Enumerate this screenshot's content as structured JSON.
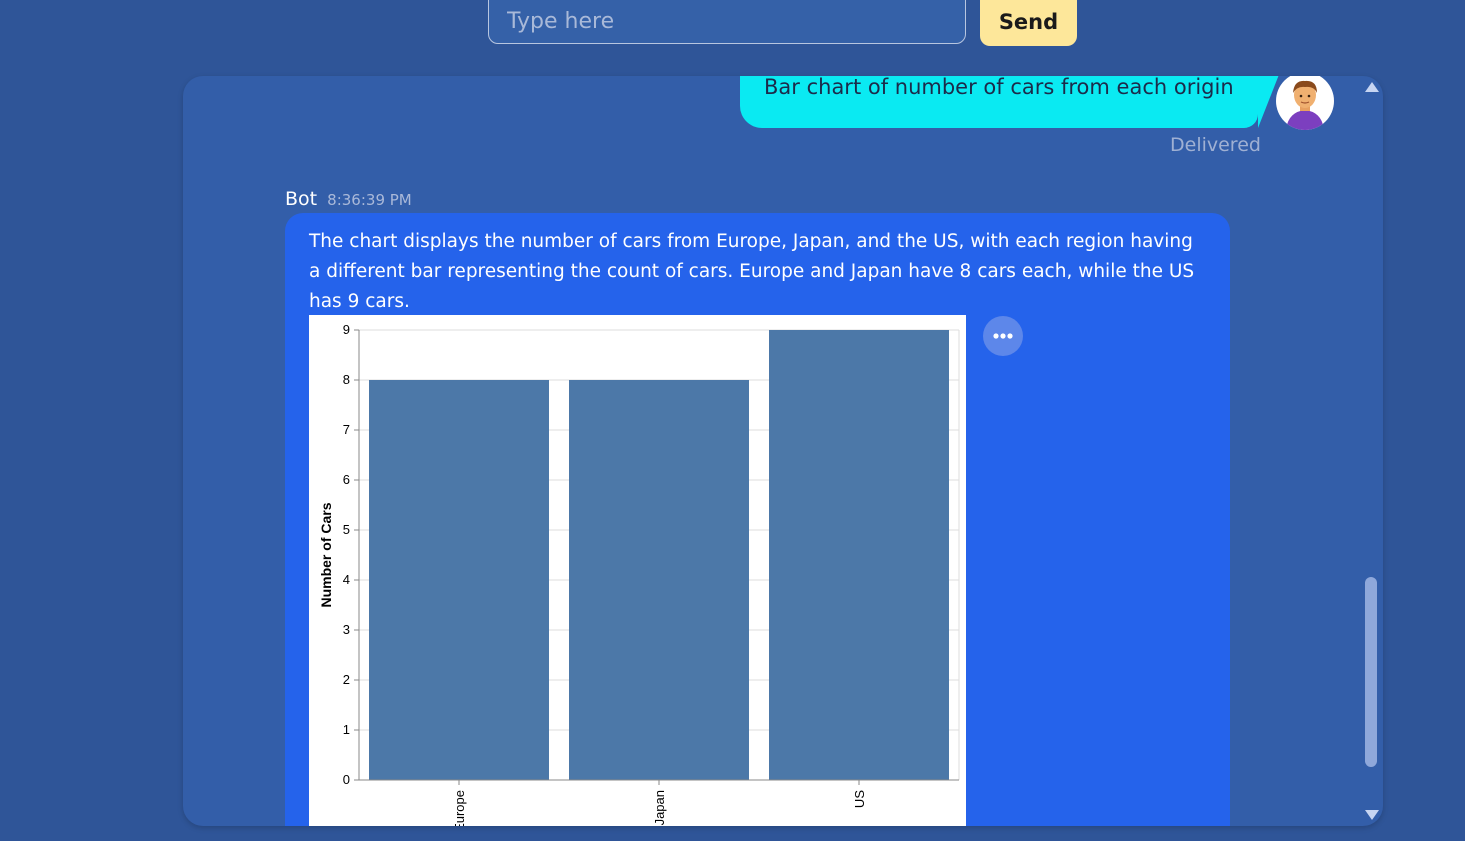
{
  "input": {
    "placeholder": "Type here",
    "send_label": "Send",
    "send_color": "#fde79a"
  },
  "user_message": {
    "text": "Bar chart of number of cars from each origin",
    "status": "Delivered",
    "bubble_color": "#0aeaf2",
    "avatar_icon": "user-avatar-icon"
  },
  "bot_message": {
    "sender": "Bot",
    "time": "8:36:39 PM",
    "text": "The chart displays the number of cars from Europe, Japan, and the US, with each region having a different bar representing the count of cars. Europe and Japan have 8 cars each, while the US has 9 cars.",
    "bubble_color": "#2563eb",
    "more_icon": "more-options-icon"
  },
  "chart_data": {
    "type": "bar",
    "categories": [
      "Europe",
      "Japan",
      "US"
    ],
    "values": [
      8,
      8,
      9
    ],
    "ylabel": "Number of Cars",
    "xlabel": "",
    "ylim": [
      0,
      9
    ],
    "yticks": [
      0,
      1,
      2,
      3,
      4,
      5,
      6,
      7,
      8,
      9
    ],
    "bar_color": "#4c78a8",
    "grid": true
  },
  "colors": {
    "page_background": "#2f5598",
    "panel_background": "#335ea9"
  }
}
